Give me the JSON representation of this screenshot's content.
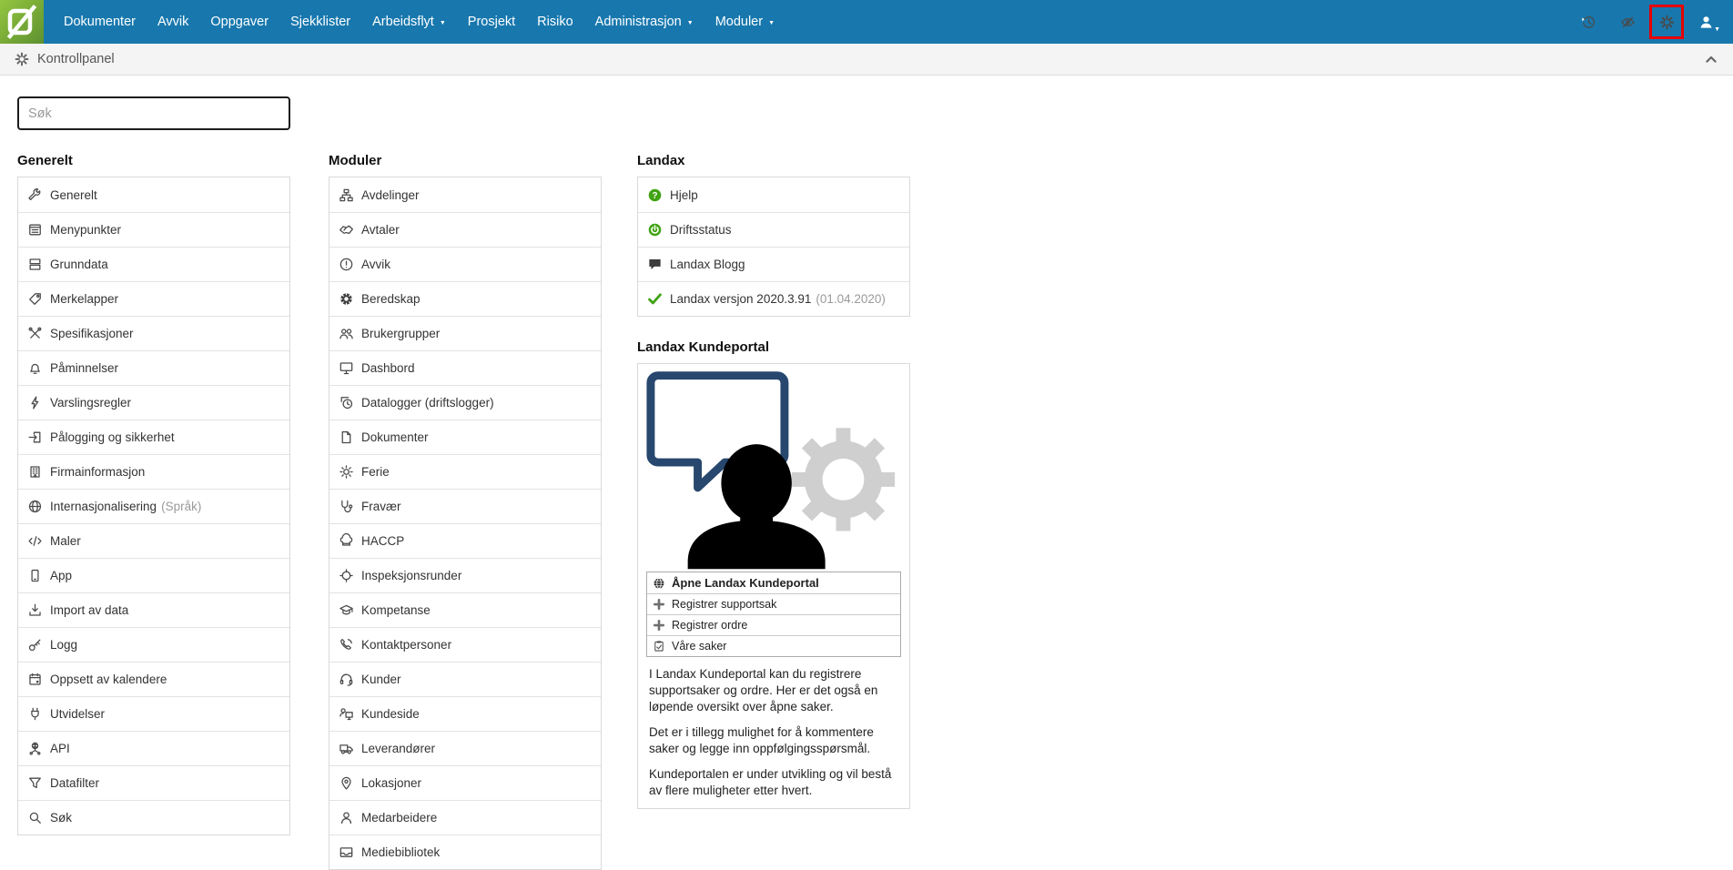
{
  "navbar": {
    "items": [
      {
        "label": "Dokumenter",
        "caret": false
      },
      {
        "label": "Avvik",
        "caret": false
      },
      {
        "label": "Oppgaver",
        "caret": false
      },
      {
        "label": "Sjekklister",
        "caret": false
      },
      {
        "label": "Arbeidsflyt",
        "caret": true
      },
      {
        "label": "Prosjekt",
        "caret": false
      },
      {
        "label": "Risiko",
        "caret": false
      },
      {
        "label": "Administrasjon",
        "caret": true
      },
      {
        "label": "Moduler",
        "caret": true
      }
    ]
  },
  "breadcrumb": {
    "title": "Kontrollpanel"
  },
  "search": {
    "placeholder": "Søk"
  },
  "columns": {
    "generelt": {
      "heading": "Generelt",
      "items": [
        {
          "icon": "wrench",
          "label": "Generelt"
        },
        {
          "icon": "menu",
          "label": "Menypunkter"
        },
        {
          "icon": "layers",
          "label": "Grunndata"
        },
        {
          "icon": "tag",
          "label": "Merkelapper"
        },
        {
          "icon": "tools",
          "label": "Spesifikasjoner"
        },
        {
          "icon": "bell",
          "label": "Påminnelser"
        },
        {
          "icon": "bolt",
          "label": "Varslingsregler"
        },
        {
          "icon": "login",
          "label": "Pålogging og sikkerhet"
        },
        {
          "icon": "building",
          "label": "Firmainformasjon"
        },
        {
          "icon": "globe",
          "label": "Internasjonalisering",
          "suffix": "(Språk)"
        },
        {
          "icon": "code",
          "label": "Maler"
        },
        {
          "icon": "phone",
          "label": "App"
        },
        {
          "icon": "import",
          "label": "Import av data"
        },
        {
          "icon": "key",
          "label": "Logg"
        },
        {
          "icon": "calendar",
          "label": "Oppsett av kalendere"
        },
        {
          "icon": "plug",
          "label": "Utvidelser"
        },
        {
          "icon": "api",
          "label": "API"
        },
        {
          "icon": "funnel",
          "label": "Datafilter"
        },
        {
          "icon": "search",
          "label": "Søk"
        }
      ]
    },
    "moduler": {
      "heading": "Moduler",
      "items": [
        {
          "icon": "orgchart",
          "label": "Avdelinger"
        },
        {
          "icon": "handshake",
          "label": "Avtaler"
        },
        {
          "icon": "alert",
          "label": "Avvik"
        },
        {
          "icon": "lifebuoy",
          "label": "Beredskap"
        },
        {
          "icon": "users",
          "label": "Brukergrupper"
        },
        {
          "icon": "monitor",
          "label": "Dashbord"
        },
        {
          "icon": "clockcopy",
          "label": "Datalogger (driftslogger)"
        },
        {
          "icon": "file",
          "label": "Dokumenter"
        },
        {
          "icon": "sun",
          "label": "Ferie"
        },
        {
          "icon": "stethoscope",
          "label": "Fravær"
        },
        {
          "icon": "chefhat",
          "label": "HACCP"
        },
        {
          "icon": "crosshair",
          "label": "Inspeksjonsrunder"
        },
        {
          "icon": "gradcap",
          "label": "Kompetanse"
        },
        {
          "icon": "phonecall",
          "label": "Kontaktpersoner"
        },
        {
          "icon": "headset",
          "label": "Kunder"
        },
        {
          "icon": "userscreen",
          "label": "Kundeside"
        },
        {
          "icon": "truck",
          "label": "Leverandører"
        },
        {
          "icon": "pin",
          "label": "Lokasjoner"
        },
        {
          "icon": "person",
          "label": "Medarbeidere"
        },
        {
          "icon": "media",
          "label": "Mediebibliotek"
        }
      ]
    },
    "landax": {
      "heading": "Landax",
      "items": [
        {
          "icon": "help",
          "label": "Hjelp"
        },
        {
          "icon": "power",
          "label": "Driftsstatus"
        },
        {
          "icon": "blog",
          "label": "Landax Blogg"
        },
        {
          "icon": "check",
          "label": "Landax versjon 2020.3.91",
          "suffix": "(01.04.2020)"
        }
      ]
    }
  },
  "kundeportal": {
    "heading": "Landax Kundeportal",
    "menu": [
      {
        "icon": "globedark",
        "label": "Åpne Landax Kundeportal",
        "bold": true
      },
      {
        "icon": "plus",
        "label": "Registrer supportsak"
      },
      {
        "icon": "plus",
        "label": "Registrer ordre"
      },
      {
        "icon": "clipboard",
        "label": "Våre saker"
      }
    ],
    "paragraphs": [
      "I Landax Kundeportal kan du registrere supportsaker og ordre. Her er det også en løpende oversikt over åpne saker.",
      "Det er i tillegg mulighet for å kommentere saker og legge inn oppfølgingsspørsmål.",
      "Kundeportalen er under utvikling og vil bestå av flere muligheter etter hvert."
    ]
  },
  "colors": {
    "navbar_blue": "#1878ae",
    "highlight_red": "#e60000",
    "accent_green": "#3fa313",
    "logo_green": "#76a93c"
  }
}
